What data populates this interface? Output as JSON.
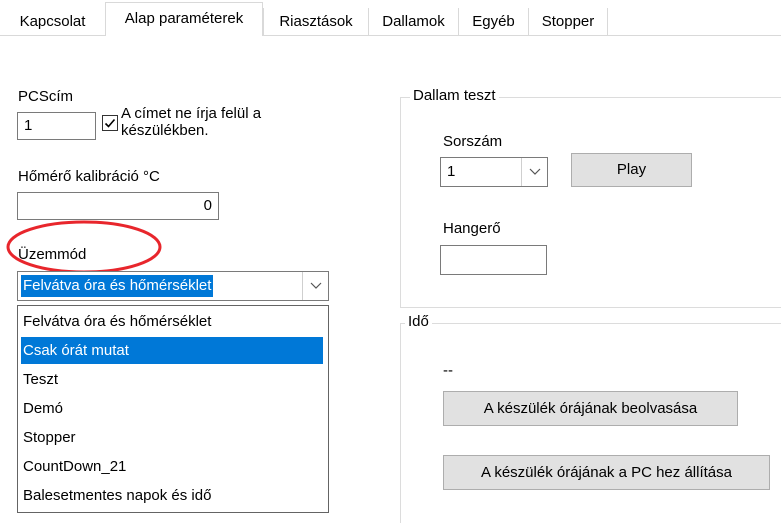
{
  "tabs": [
    {
      "label": "Kapcsolat"
    },
    {
      "label": "Alap paraméterek"
    },
    {
      "label": "Riasztások"
    },
    {
      "label": "Dallamok"
    },
    {
      "label": "Egyéb"
    },
    {
      "label": "Stopper"
    }
  ],
  "active_tab": "Alap paraméterek",
  "left": {
    "pcs_label": "PCScím",
    "pcs_value": "1",
    "checkbox_label_line1": "A címet ne írja felül a",
    "checkbox_label_line2": "készülékben.",
    "checkbox_checked": true,
    "calib_label": "Hőmérő kalibráció °C",
    "calib_value": "0",
    "mode_label": "Üzemmód",
    "mode_selected": "Felvátva óra és hőmérséklet",
    "mode_options": [
      "Felvátva óra és hőmérséklet",
      "Csak órát mutat",
      "Teszt",
      "Demó",
      "Stopper",
      "CountDown_21",
      "Balesetmentes napok és idő"
    ],
    "highlighted_option_index": 1
  },
  "dallam": {
    "group_title": "Dallam teszt",
    "sorszam_label": "Sorszám",
    "sorszam_value": "1",
    "play_label": "Play",
    "hangero_label": "Hangerő",
    "hangero_value": ""
  },
  "ido": {
    "group_title": "Idő",
    "time_text": "--",
    "read_button": "A készülék órájának beolvasása",
    "set_button": "A készülék órájának a PC hez állítása"
  },
  "annotation_color": "#e8262c",
  "accent_color": "#0078d7"
}
